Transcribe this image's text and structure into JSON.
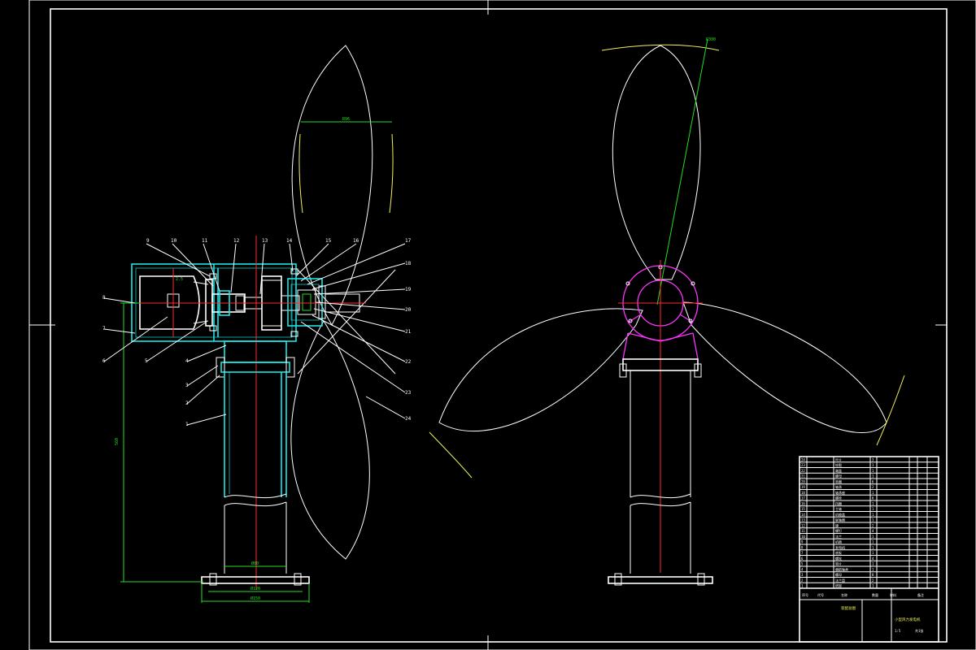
{
  "balloons_side": [
    "9",
    "10",
    "11",
    "12",
    "13",
    "14",
    "15",
    "16",
    "17",
    "18",
    "19",
    "20",
    "21",
    "22",
    "23",
    "24"
  ],
  "balloons_left": [
    "8",
    "7",
    "6",
    "5",
    "4",
    "3",
    "2",
    "1"
  ],
  "dims": {
    "blade_width": "R96",
    "base_inner": "Ø80",
    "base_mid": "Ø120",
    "base_outer": "Ø150",
    "height": "560",
    "small_left": "2.5",
    "blade_angle": "R300"
  },
  "title_block": {
    "drawing_title": "小型风力发电机",
    "assembly_label": "装配总图",
    "scale": "1:5",
    "sheet": "共1张",
    "headers": [
      "序号",
      "代号",
      "名称",
      "数量",
      "材料",
      "备注"
    ]
  },
  "bom_rows": [
    {
      "no": "24",
      "name": "叶片",
      "qty": "3"
    },
    {
      "no": "23",
      "name": "轮毂",
      "qty": "1"
    },
    {
      "no": "22",
      "name": "端盖",
      "qty": "1"
    },
    {
      "no": "21",
      "name": "螺母",
      "qty": "1"
    },
    {
      "no": "20",
      "name": "垫圈",
      "qty": "6"
    },
    {
      "no": "19",
      "name": "轴承",
      "qty": "2"
    },
    {
      "no": "18",
      "name": "轴承座",
      "qty": "1"
    },
    {
      "no": "17",
      "name": "螺栓",
      "qty": "6"
    },
    {
      "no": "16",
      "name": "挡圈",
      "qty": "1"
    },
    {
      "no": "15",
      "name": "主轴",
      "qty": "1"
    },
    {
      "no": "14",
      "name": "机舱盖",
      "qty": "1"
    },
    {
      "no": "13",
      "name": "联轴器",
      "qty": "1"
    },
    {
      "no": "12",
      "name": "键",
      "qty": "2"
    },
    {
      "no": "11",
      "name": "螺钉",
      "qty": "4"
    },
    {
      "no": "10",
      "name": "法兰",
      "qty": "1"
    },
    {
      "no": "9",
      "name": "机舱",
      "qty": "1"
    },
    {
      "no": "8",
      "name": "发电机",
      "qty": "1"
    },
    {
      "no": "7",
      "name": "底板",
      "qty": "1"
    },
    {
      "no": "6",
      "name": "螺栓",
      "qty": "4"
    },
    {
      "no": "5",
      "name": "垫片",
      "qty": "1"
    },
    {
      "no": "4",
      "name": "偏航轴承",
      "qty": "1"
    },
    {
      "no": "3",
      "name": "螺母",
      "qty": "8"
    },
    {
      "no": "2",
      "name": "法兰盘",
      "qty": "2"
    },
    {
      "no": "1",
      "name": "塔架",
      "qty": "1"
    }
  ]
}
